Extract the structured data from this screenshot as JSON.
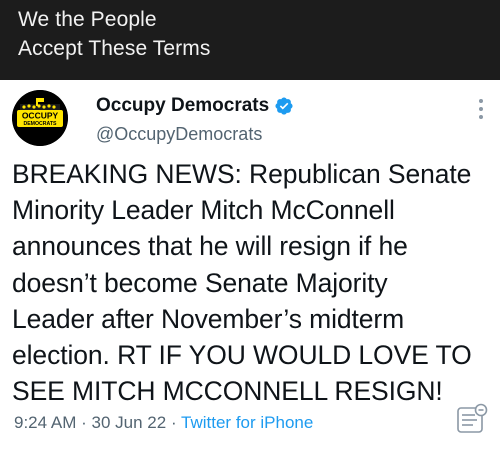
{
  "banner": {
    "line1": "We the People",
    "line2": "Accept These Terms"
  },
  "tweet": {
    "avatar_text_top": "OCCUPY",
    "avatar_text_bottom": "DEMOCRATS",
    "display_name": "Occupy Democrats",
    "handle": "@OccupyDemocrats",
    "text_lines": [
      "BREAKING NEWS: Republican Senate",
      "Minority Leader Mitch McConnell",
      "announces that he will resign if he",
      "doesn’t become Senate Majority",
      "Leader after November’s midterm",
      "election. RT IF YOU WOULD LOVE TO",
      "SEE MITCH MCCONNELL RESIGN!"
    ],
    "time": "9:24 AM",
    "date": "30 Jun 22",
    "separator": "·",
    "source": "Twitter for iPhone"
  },
  "icons": {
    "verified": "verified-badge-icon",
    "more": "more-options-icon",
    "analytics": "analytics-icon"
  },
  "colors": {
    "banner_bg": "#1c1c1c",
    "verified_blue": "#1d9bf0",
    "link_blue": "#1d9bf0",
    "avatar_yellow": "#ffe500",
    "secondary_text": "#536471"
  }
}
